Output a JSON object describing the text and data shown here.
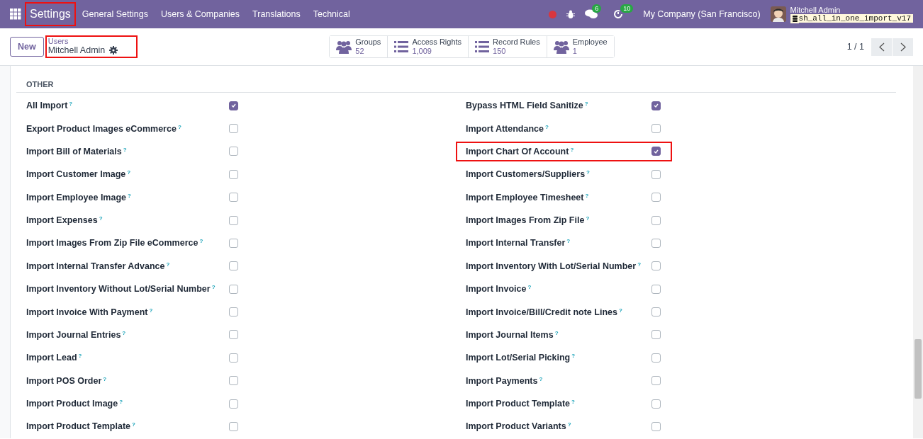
{
  "navbar": {
    "app": {
      "label": "Settings",
      "highlighted": true
    },
    "menu": [
      "General Settings",
      "Users & Companies",
      "Translations",
      "Technical"
    ],
    "chat_count": "6",
    "activity_count": "10",
    "company": "My Company (San Francisco)",
    "user": "Mitchell Admin",
    "database": "sh_all_in_one_import_v17"
  },
  "control_panel": {
    "new_button": "New",
    "breadcrumb": {
      "parent": "Users",
      "current": "Mitchell Admin",
      "highlighted": true
    },
    "smart_buttons": [
      {
        "kind": "people",
        "label": "Groups",
        "value": "52"
      },
      {
        "kind": "list",
        "label": "Access Rights",
        "value": "1,009"
      },
      {
        "kind": "list",
        "label": "Record Rules",
        "value": "150"
      },
      {
        "kind": "people",
        "label": "Employee",
        "value": "1"
      }
    ],
    "pager": "1 / 1"
  },
  "section": {
    "title": "OTHER",
    "left": [
      {
        "label": "All Import",
        "help": "?",
        "checked": true,
        "highlighted": false
      },
      {
        "label": "Export Product Images eCommerce",
        "help": "?",
        "checked": false,
        "highlighted": false
      },
      {
        "label": "Import Bill of Materials",
        "help": "?",
        "checked": false,
        "highlighted": false
      },
      {
        "label": "Import Customer Image",
        "help": "?",
        "checked": false,
        "highlighted": false
      },
      {
        "label": "Import Employee Image",
        "help": "?",
        "checked": false,
        "highlighted": false
      },
      {
        "label": "Import Expenses",
        "help": "?",
        "checked": false,
        "highlighted": false
      },
      {
        "label": "Import Images From Zip File eCommerce",
        "help": "?",
        "checked": false,
        "highlighted": false
      },
      {
        "label": "Import Internal Transfer Advance",
        "help": "?",
        "checked": false,
        "highlighted": false
      },
      {
        "label": "Import Inventory Without Lot/Serial Number",
        "help": "?",
        "checked": false,
        "highlighted": false
      },
      {
        "label": "Import Invoice With Payment",
        "help": "?",
        "checked": false,
        "highlighted": false
      },
      {
        "label": "Import Journal Entries",
        "help": "?",
        "checked": false,
        "highlighted": false
      },
      {
        "label": "Import Lead",
        "help": "?",
        "checked": false,
        "highlighted": false
      },
      {
        "label": "Import POS Order",
        "help": "?",
        "checked": false,
        "highlighted": false
      },
      {
        "label": "Import Product Image",
        "help": "?",
        "checked": false,
        "highlighted": false
      },
      {
        "label": "Import Product Template",
        "help": "?",
        "checked": false,
        "highlighted": false
      }
    ],
    "right": [
      {
        "label": "Bypass HTML Field Sanitize",
        "help": "?",
        "checked": true,
        "highlighted": false
      },
      {
        "label": "Import Attendance",
        "help": "?",
        "checked": false,
        "highlighted": false
      },
      {
        "label": "Import Chart Of Account",
        "help": "?",
        "checked": true,
        "highlighted": true
      },
      {
        "label": "Import Customers/Suppliers",
        "help": "?",
        "checked": false,
        "highlighted": false
      },
      {
        "label": "Import Employee Timesheet",
        "help": "?",
        "checked": false,
        "highlighted": false
      },
      {
        "label": "Import Images From Zip File",
        "help": "?",
        "checked": false,
        "highlighted": false
      },
      {
        "label": "Import Internal Transfer",
        "help": "?",
        "checked": false,
        "highlighted": false
      },
      {
        "label": "Import Inventory With Lot/Serial Number",
        "help": "?",
        "checked": false,
        "highlighted": false
      },
      {
        "label": "Import Invoice",
        "help": "?",
        "checked": false,
        "highlighted": false
      },
      {
        "label": "Import Invoice/Bill/Credit note Lines",
        "help": "?",
        "checked": false,
        "highlighted": false
      },
      {
        "label": "Import Journal Items",
        "help": "?",
        "checked": false,
        "highlighted": false
      },
      {
        "label": "Import Lot/Serial Picking",
        "help": "?",
        "checked": false,
        "highlighted": false
      },
      {
        "label": "Import Payments",
        "help": "?",
        "checked": false,
        "highlighted": false
      },
      {
        "label": "Import Product Template",
        "help": "?",
        "checked": false,
        "highlighted": false
      },
      {
        "label": "Import Product Variants",
        "help": "?",
        "checked": false,
        "highlighted": false
      }
    ]
  }
}
